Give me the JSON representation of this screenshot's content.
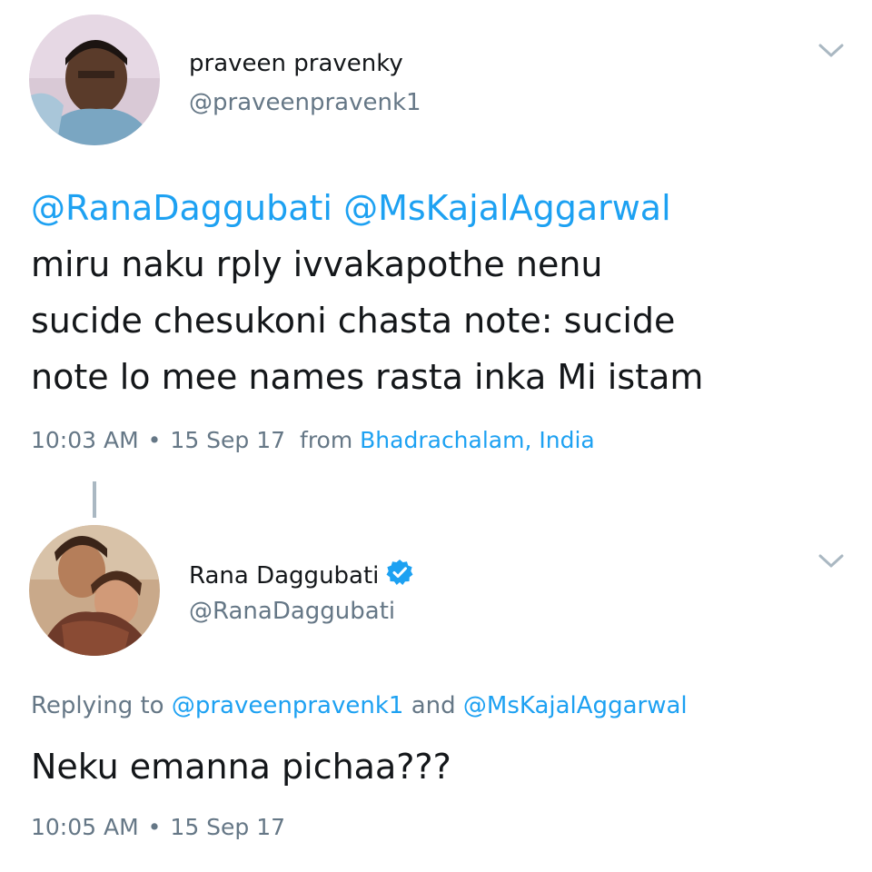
{
  "tweet1": {
    "avatar": "avatar-praveen",
    "name": "praveen pravenky",
    "handle": "@praveenpravenk1",
    "mention_1": "@RanaDaggubati",
    "mention_2": "@MsKajalAggarwal",
    "text_line_1": "miru naku rply ivvakapothe nenu",
    "text_line_2": "sucide chesukoni chasta note: sucide",
    "text_line_3": "note lo mee names rasta inka Mi istam",
    "time": "10:03 AM",
    "separator": "•",
    "date": "15 Sep 17",
    "from_label": "from",
    "location": "Bhadrachalam, India",
    "chevron_icon": "chevron-down-icon"
  },
  "tweet2": {
    "avatar": "avatar-rana",
    "name": "Rana Daggubati",
    "verified_icon": "verified-badge-icon",
    "handle": "@RanaDaggubati",
    "replying_prefix": "Replying to",
    "replying_mention_1": "@praveenpravenk1",
    "replying_and": "and",
    "replying_mention_2": "@MsKajalAggarwal",
    "text": "Neku emanna pichaa???",
    "time": "10:05 AM",
    "separator": "•",
    "date": "15 Sep 17",
    "chevron_icon": "chevron-down-icon"
  },
  "colors": {
    "link": "#1da1f2",
    "muted": "#657786",
    "text": "#14171a",
    "thread_line": "#aab8c2"
  }
}
